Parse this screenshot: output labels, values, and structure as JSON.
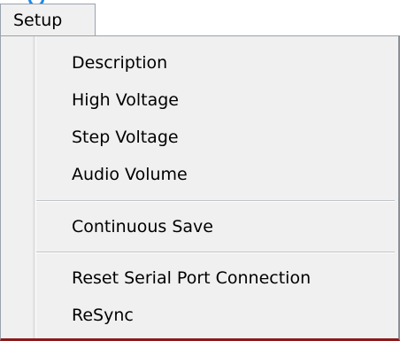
{
  "menu": {
    "title": "Setup",
    "items": [
      {
        "label": "Description"
      },
      {
        "label": "High Voltage"
      },
      {
        "label": "Step Voltage"
      },
      {
        "label": "Audio Volume"
      },
      {
        "label": "Continuous Save"
      },
      {
        "label": "Reset Serial Port Connection"
      },
      {
        "label": "ReSync"
      }
    ]
  },
  "colors": {
    "menu_background": "#f0f0f0",
    "border": "#9aa3ad",
    "window_edge": "#8b1a1a",
    "cut_off_text": "#1e88e5"
  }
}
